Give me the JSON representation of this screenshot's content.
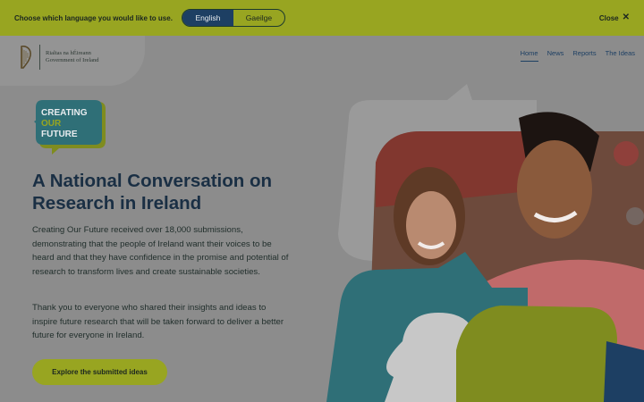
{
  "lang_bar": {
    "prompt": "Choose which language you would like to use.",
    "options": [
      "English",
      "Gaeilge"
    ],
    "selected": "English",
    "close_label": "Close",
    "background_color": "#98a521"
  },
  "header": {
    "gov_logo": {
      "line1": "Rialtas na hÉireann",
      "line2": "Government of Ireland"
    },
    "nav": [
      "Home",
      "News",
      "Reports",
      "The Ideas"
    ],
    "active_nav": "Home"
  },
  "hero": {
    "badge": {
      "line1": "CREATING",
      "line2": "OUR",
      "line3": "FUTURE"
    },
    "headline": "A National Conversation on Research in Ireland",
    "paragraph1": "Creating Our Future received over 18,000 submissions, demonstrating that the people of Ireland want their voices to be heard and that they have confidence in the promise and potential of research to transform lives and create sustainable societies.",
    "paragraph2": "Thank you to everyone who shared their insights and ideas to inspire future research that will be taken forward to deliver a better future for everyone in Ireland.",
    "cta_label": "Explore the submitted ideas",
    "image_icon": "two-people-smiling-photo"
  },
  "colors": {
    "accent_green": "#98a521",
    "navy": "#1d3f63",
    "teal": "#2f6f77",
    "overlay_gray": "#8c8c8c"
  }
}
